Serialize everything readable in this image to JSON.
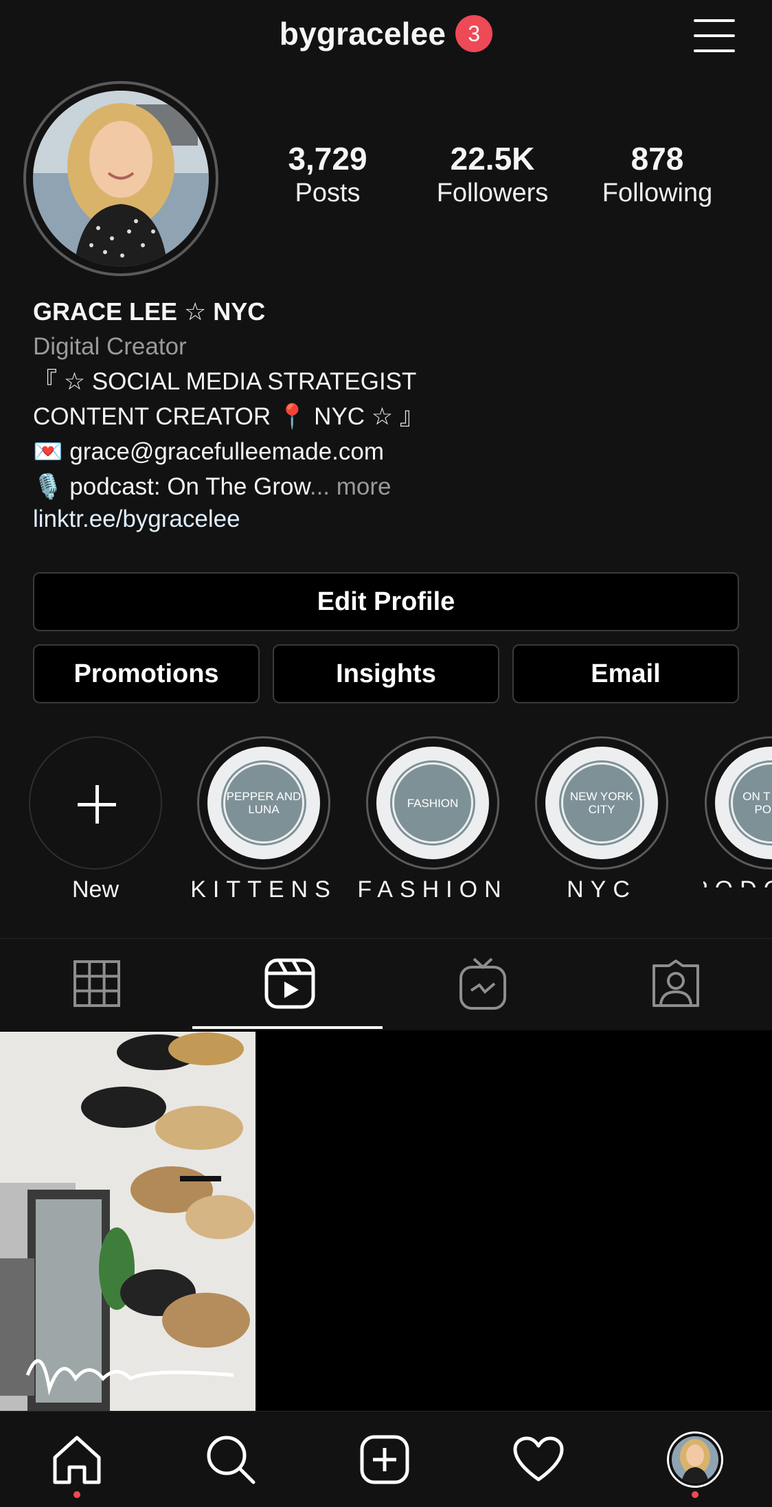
{
  "header": {
    "username": "bygracelee",
    "notification_count": "3",
    "menu_icon": "hamburger-menu-icon"
  },
  "stats": [
    {
      "value": "3,729",
      "label": "Posts"
    },
    {
      "value": "22.5K",
      "label": "Followers"
    },
    {
      "value": "878",
      "label": "Following"
    }
  ],
  "bio": {
    "name": "GRACE LEE ☆ NYC",
    "category": "Digital Creator",
    "line1": "『 ☆ SOCIAL MEDIA STRATEGIST",
    "line2": "CONTENT CREATOR 📍 NYC ☆ 』",
    "email_line": "💌 grace@gracefulleemade.com",
    "podcast_line": "🎙️ podcast: On The Grow",
    "ellipsis": "...",
    "more": "more",
    "link": "linktr.ee/bygracelee"
  },
  "buttons": {
    "edit_profile": "Edit Profile",
    "promotions": "Promotions",
    "insights": "Insights",
    "email": "Email"
  },
  "highlights": [
    {
      "label": "New",
      "cover_text": "+"
    },
    {
      "label": "KITTENS",
      "cover_text": "PEPPER AND LUNA"
    },
    {
      "label": "FASHION",
      "cover_text": "FASHION"
    },
    {
      "label": "NYC",
      "cover_text": "NEW YORK CITY"
    },
    {
      "label": "PODC",
      "cover_text": "ON T GRO PODC"
    }
  ],
  "tabs": [
    {
      "name": "grid-icon",
      "active": false
    },
    {
      "name": "reels-icon",
      "active": true
    },
    {
      "name": "igtv-icon",
      "active": false
    },
    {
      "name": "tagged-icon",
      "active": false
    }
  ],
  "posts": [
    {
      "caption_overlay": "home"
    }
  ],
  "bottom_nav": [
    {
      "name": "home-icon",
      "has_dot": true
    },
    {
      "name": "search-icon",
      "has_dot": false
    },
    {
      "name": "new-post-icon",
      "has_dot": false
    },
    {
      "name": "activity-heart-icon",
      "has_dot": false
    },
    {
      "name": "profile-avatar-icon",
      "has_dot": true
    }
  ],
  "colors": {
    "background": "#121212",
    "badge": "#ed4956",
    "secondary_text": "#9a9a9a"
  }
}
